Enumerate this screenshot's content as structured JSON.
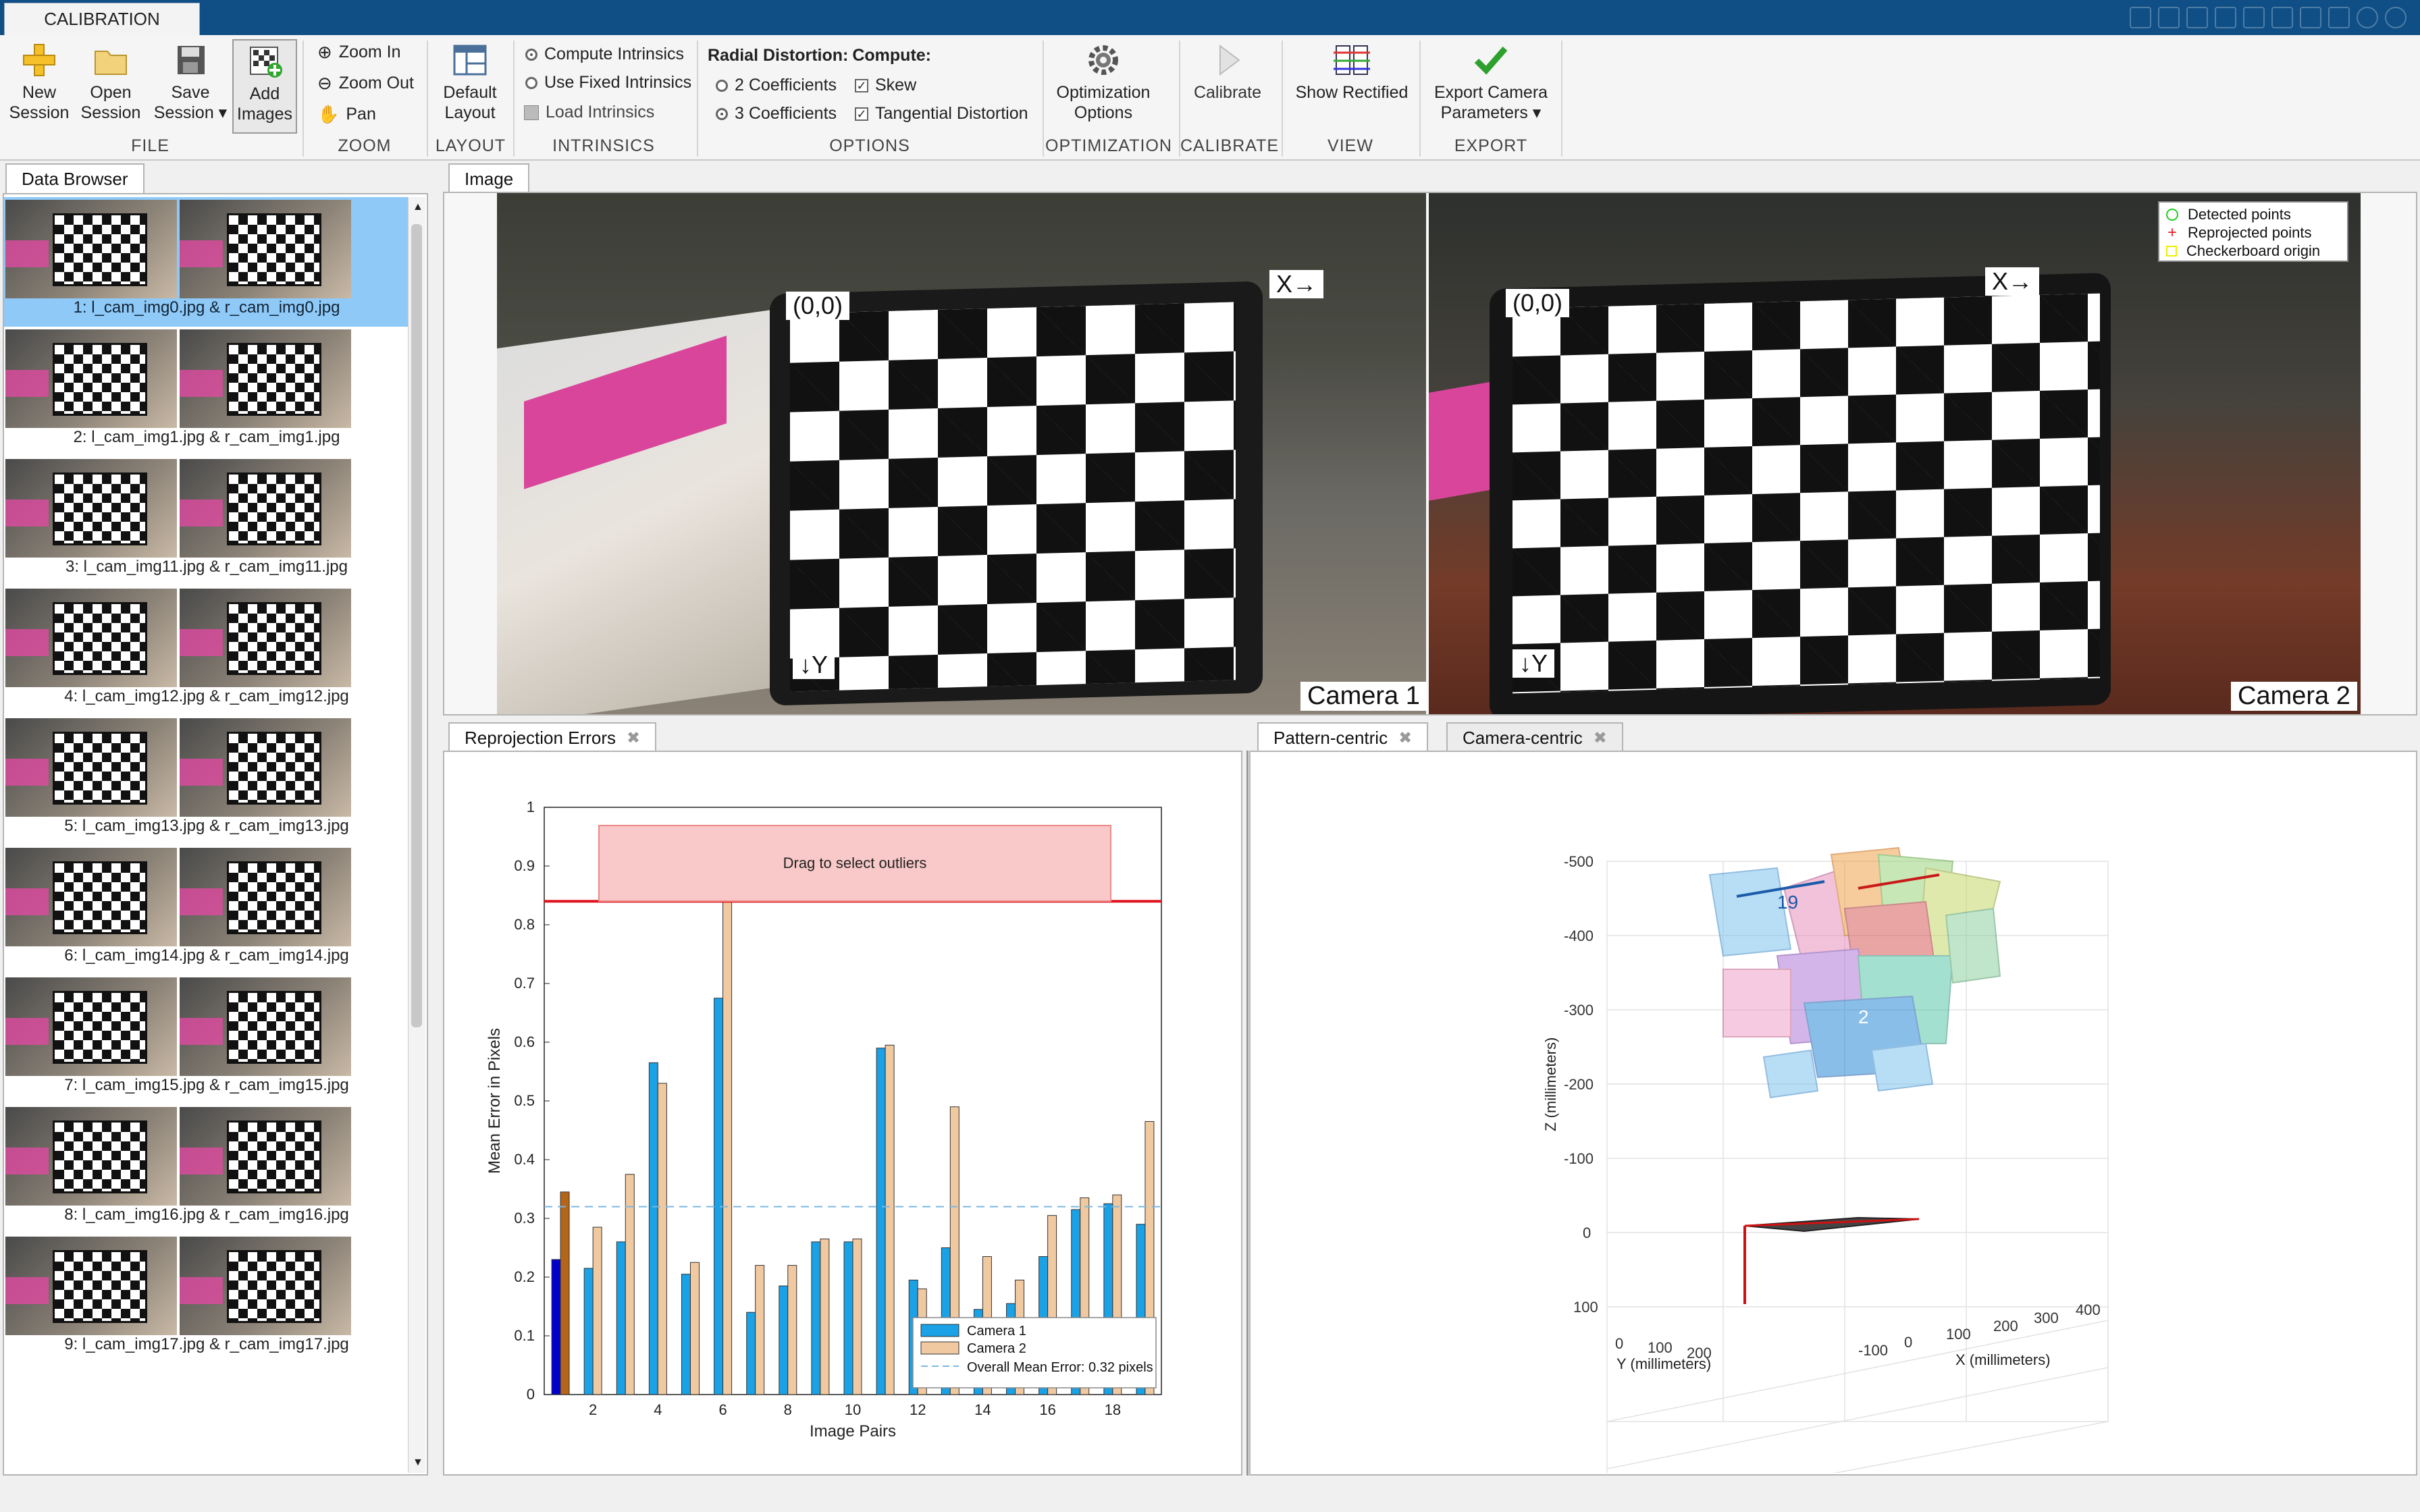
{
  "app": {
    "tab_label": "CALIBRATION"
  },
  "ribbon": {
    "file": {
      "group": "FILE",
      "new_session": [
        "New",
        "Session"
      ],
      "open_session": [
        "Open",
        "Session"
      ],
      "save_session": [
        "Save",
        "Session ▾"
      ],
      "add_images": [
        "Add",
        "Images"
      ]
    },
    "zoom": {
      "group": "ZOOM",
      "zoom_in": "Zoom In",
      "zoom_out": "Zoom Out",
      "pan": "Pan"
    },
    "layout": {
      "group": "LAYOUT",
      "default_layout": [
        "Default",
        "Layout"
      ]
    },
    "intrinsics": {
      "group": "INTRINSICS",
      "compute": "Compute Intrinsics",
      "fixed": "Use Fixed Intrinsics",
      "load": "Load Intrinsics"
    },
    "options": {
      "group": "OPTIONS",
      "radial_label": "Radial Distortion:",
      "compute_label": "Compute:",
      "two_coeff": "2 Coefficients",
      "three_coeff": "3 Coefficients",
      "skew": "Skew",
      "tangential": "Tangential Distortion"
    },
    "optimization": {
      "group": "OPTIMIZATION",
      "button": [
        "Optimization",
        "Options"
      ]
    },
    "calibrate": {
      "group": "CALIBRATE",
      "button": "Calibrate"
    },
    "view": {
      "group": "VIEW",
      "button": "Show Rectified"
    },
    "export": {
      "group": "EXPORT",
      "button": [
        "Export Camera",
        "Parameters ▾"
      ]
    }
  },
  "data_browser": {
    "tab": "Data Browser",
    "items": [
      "1: l_cam_img0.jpg & r_cam_img0.jpg",
      "2: l_cam_img1.jpg & r_cam_img1.jpg",
      "3: l_cam_img11.jpg & r_cam_img11.jpg",
      "4: l_cam_img12.jpg & r_cam_img12.jpg",
      "5: l_cam_img13.jpg & r_cam_img13.jpg",
      "6: l_cam_img14.jpg & r_cam_img14.jpg",
      "7: l_cam_img15.jpg & r_cam_img15.jpg",
      "8: l_cam_img16.jpg & r_cam_img16.jpg",
      "9: l_cam_img17.jpg & r_cam_img17.jpg"
    ],
    "selected_index": 0
  },
  "image_panel": {
    "tab": "Image",
    "origin": "(0,0)",
    "x_axis": "X→",
    "y_axis": "↓Y",
    "camera1": "Camera 1",
    "camera2": "Camera 2",
    "legend": [
      "Detected points",
      "Reprojected points",
      "Checkerboard origin"
    ]
  },
  "reprojection": {
    "tab": "Reprojection Errors",
    "drag_hint": "Drag to select outliers"
  },
  "extrinsics": {
    "tab_active": "Pattern-centric",
    "tab_other": "Camera-centric",
    "z_label": "Z (millimeters)",
    "y_label": "Y (millimeters)",
    "x_label": "X (millimeters)",
    "z_ticks": [
      "-500",
      "-400",
      "-300",
      "-200",
      "-100",
      "0",
      "100"
    ],
    "y_ticks": [
      "0",
      "100",
      "200"
    ],
    "x_ticks": [
      "-100",
      "0",
      "100",
      "200",
      "300",
      "400"
    ],
    "labels": [
      "19",
      "2"
    ]
  },
  "chart_data": {
    "type": "bar",
    "xlabel": "Image Pairs",
    "ylabel": "Mean Error in Pixels",
    "ylim": [
      0,
      1
    ],
    "yticks": [
      0,
      0.1,
      0.2,
      0.3,
      0.4,
      0.5,
      0.6,
      0.7,
      0.8,
      0.9,
      1
    ],
    "xticks": [
      2,
      4,
      6,
      8,
      10,
      12,
      14,
      16,
      18
    ],
    "categories": [
      1,
      2,
      3,
      4,
      5,
      6,
      7,
      8,
      9,
      10,
      11,
      12,
      13,
      14,
      15,
      16,
      17,
      18,
      19
    ],
    "series": [
      {
        "name": "Camera 1",
        "color": "#1aa1e6",
        "values": [
          0.23,
          0.215,
          0.26,
          0.565,
          0.205,
          0.675,
          0.14,
          0.185,
          0.26,
          0.26,
          0.59,
          0.195,
          0.25,
          0.145,
          0.155,
          0.235,
          0.315,
          0.325,
          0.29
        ]
      },
      {
        "name": "Camera 2",
        "color": "#f1c9a0",
        "values": [
          0.345,
          0.285,
          0.375,
          0.53,
          0.225,
          0.84,
          0.22,
          0.22,
          0.265,
          0.265,
          0.595,
          0.18,
          0.49,
          0.235,
          0.195,
          0.305,
          0.335,
          0.34,
          0.465
        ]
      }
    ],
    "selected_bar_colors": [
      "#0000cc",
      "#b3661a"
    ],
    "overall_mean": 0.32,
    "overall_label": "Overall Mean Error: 0.32 pixels",
    "threshold": 0.84,
    "legend_position": "bottom-right"
  },
  "colors": {
    "accent": "#0f4f86",
    "selection": "#8ec9f7",
    "threshold": "#e0141e"
  }
}
